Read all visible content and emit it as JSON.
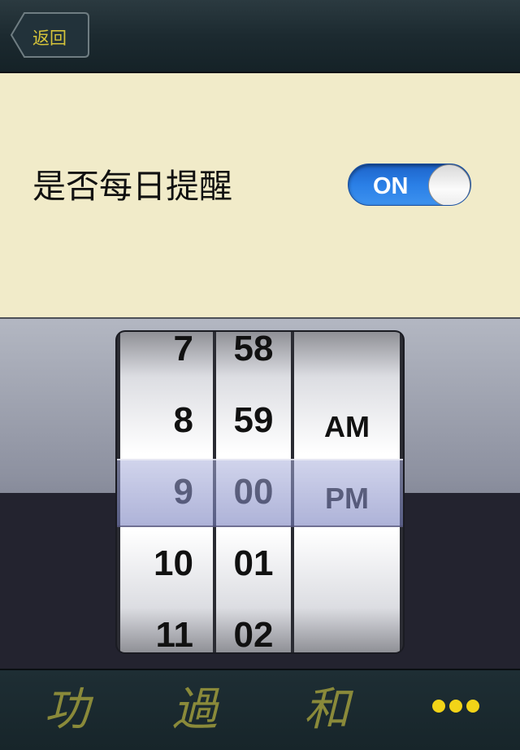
{
  "nav": {
    "back_label": "返回"
  },
  "settings": {
    "daily_reminder_label": "是否每日提醒",
    "toggle_label": "ON",
    "toggle_on": true
  },
  "picker": {
    "hours": [
      "7",
      "8",
      "9",
      "10",
      "11"
    ],
    "minutes": [
      "58",
      "59",
      "00",
      "01",
      "02"
    ],
    "periods": [
      "AM",
      "PM"
    ],
    "selected": {
      "hour": "9",
      "minute": "00",
      "period": "PM"
    }
  },
  "tabbar": {
    "tabs": [
      {
        "label": "功"
      },
      {
        "label": "過"
      },
      {
        "label": "和"
      }
    ],
    "more_icon": "more-dots-icon"
  },
  "colors": {
    "accent_yellow": "#d6c43a",
    "toggle_blue": "#2a7fe6",
    "settings_bg": "#f1ebc9"
  }
}
